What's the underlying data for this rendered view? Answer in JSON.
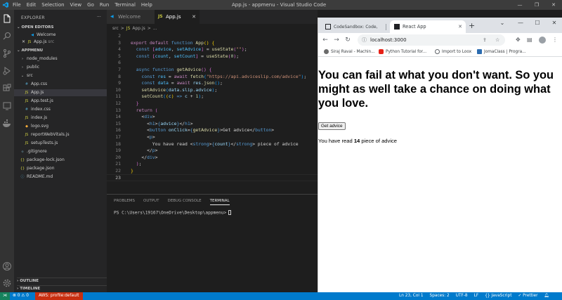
{
  "vscode": {
    "menu": [
      "File",
      "Edit",
      "Selection",
      "View",
      "Go",
      "Run",
      "Terminal",
      "Help"
    ],
    "window_title": "App.js - appmenu - Visual Studio Code",
    "activity_icons": [
      "files-icon",
      "search-icon",
      "source-control-icon",
      "run-debug-icon",
      "extensions-icon",
      "remote-explorer-icon",
      "docker-icon",
      "accounts-icon",
      "manage-gear-icon"
    ],
    "explorer": {
      "title": "EXPLORER",
      "open_editors_label": "OPEN EDITORS",
      "open_editors": [
        {
          "name": "Welcome",
          "detail": ""
        },
        {
          "name": "App.js",
          "detail": "src"
        }
      ],
      "project_label": "APPMENU",
      "tree": [
        {
          "name": "node_modules",
          "kind": "folder",
          "depth": 1
        },
        {
          "name": "public",
          "kind": "folder",
          "depth": 1
        },
        {
          "name": "src",
          "kind": "folder-open",
          "depth": 1
        },
        {
          "name": "App.css",
          "kind": "css",
          "depth": 2
        },
        {
          "name": "App.js",
          "kind": "js",
          "depth": 2,
          "active": true
        },
        {
          "name": "App.test.js",
          "kind": "js",
          "depth": 2
        },
        {
          "name": "index.css",
          "kind": "css",
          "depth": 2
        },
        {
          "name": "index.js",
          "kind": "js",
          "depth": 2
        },
        {
          "name": "logo.svg",
          "kind": "svg",
          "depth": 2
        },
        {
          "name": "reportWebVitals.js",
          "kind": "js",
          "depth": 2
        },
        {
          "name": "setupTests.js",
          "kind": "js",
          "depth": 2
        },
        {
          "name": ".gitignore",
          "kind": "git",
          "depth": 1
        },
        {
          "name": "package-lock.json",
          "kind": "json",
          "depth": 1
        },
        {
          "name": "package.json",
          "kind": "json",
          "depth": 1
        },
        {
          "name": "README.md",
          "kind": "md",
          "depth": 1
        }
      ],
      "outline_label": "OUTLINE",
      "timeline_label": "TIMELINE"
    },
    "tabs": [
      {
        "label": "Welcome",
        "icon": "vscode-icon"
      },
      {
        "label": "App.js",
        "icon": "js-icon",
        "active": true
      }
    ],
    "breadcrumb": [
      "src",
      ">",
      "JS",
      "App.js",
      ">",
      "..."
    ],
    "code_lines": [
      "2",
      "3",
      "4",
      "5",
      "6",
      "7",
      "8",
      "9",
      "10",
      "11",
      "12",
      "13",
      "14",
      "15",
      "16",
      "17",
      "18",
      "19",
      "20",
      "21",
      "22",
      "23"
    ],
    "current_line": "23",
    "panel": {
      "tabs": [
        "PROBLEMS",
        "OUTPUT",
        "DEBUG CONSOLE",
        "TERMINAL"
      ],
      "active_tab": "TERMINAL",
      "terminal_prompt": "PS C:\\Users\\19167\\OneDrive\\Desktop\\appmenu>"
    },
    "statusbar": {
      "problems": "⊗ 0 ⚠ 0",
      "aws": "AWS: profile:default",
      "position": "Ln 23, Col 1",
      "spaces": "Spaces: 2",
      "encoding": "UTF-8",
      "eol": "LF",
      "language": "{} JavaScript",
      "prettier": "✓ Prettier"
    }
  },
  "chrome": {
    "tabs": [
      {
        "label": "CodeSandbox: Code, Re...",
        "active": false
      },
      {
        "label": "React App",
        "active": true
      }
    ],
    "url": "localhost:3000",
    "bookmarks": [
      {
        "label": "Siraj Raval - Machin...",
        "color": "#6b6b6b"
      },
      {
        "label": "Python Tutorial for...",
        "color": "#e62117"
      },
      {
        "label": "Import to Loox",
        "color": "#5f6368"
      },
      {
        "label": "JomaClass | Progra...",
        "color": "#2b6cb0"
      }
    ],
    "page": {
      "advice": "You can fail at what you don't want. So you might as well take a chance on doing what you love.",
      "button_label": "Get advice",
      "count_prefix": "You have read ",
      "count": "14",
      "count_suffix": " piece of advice"
    }
  }
}
